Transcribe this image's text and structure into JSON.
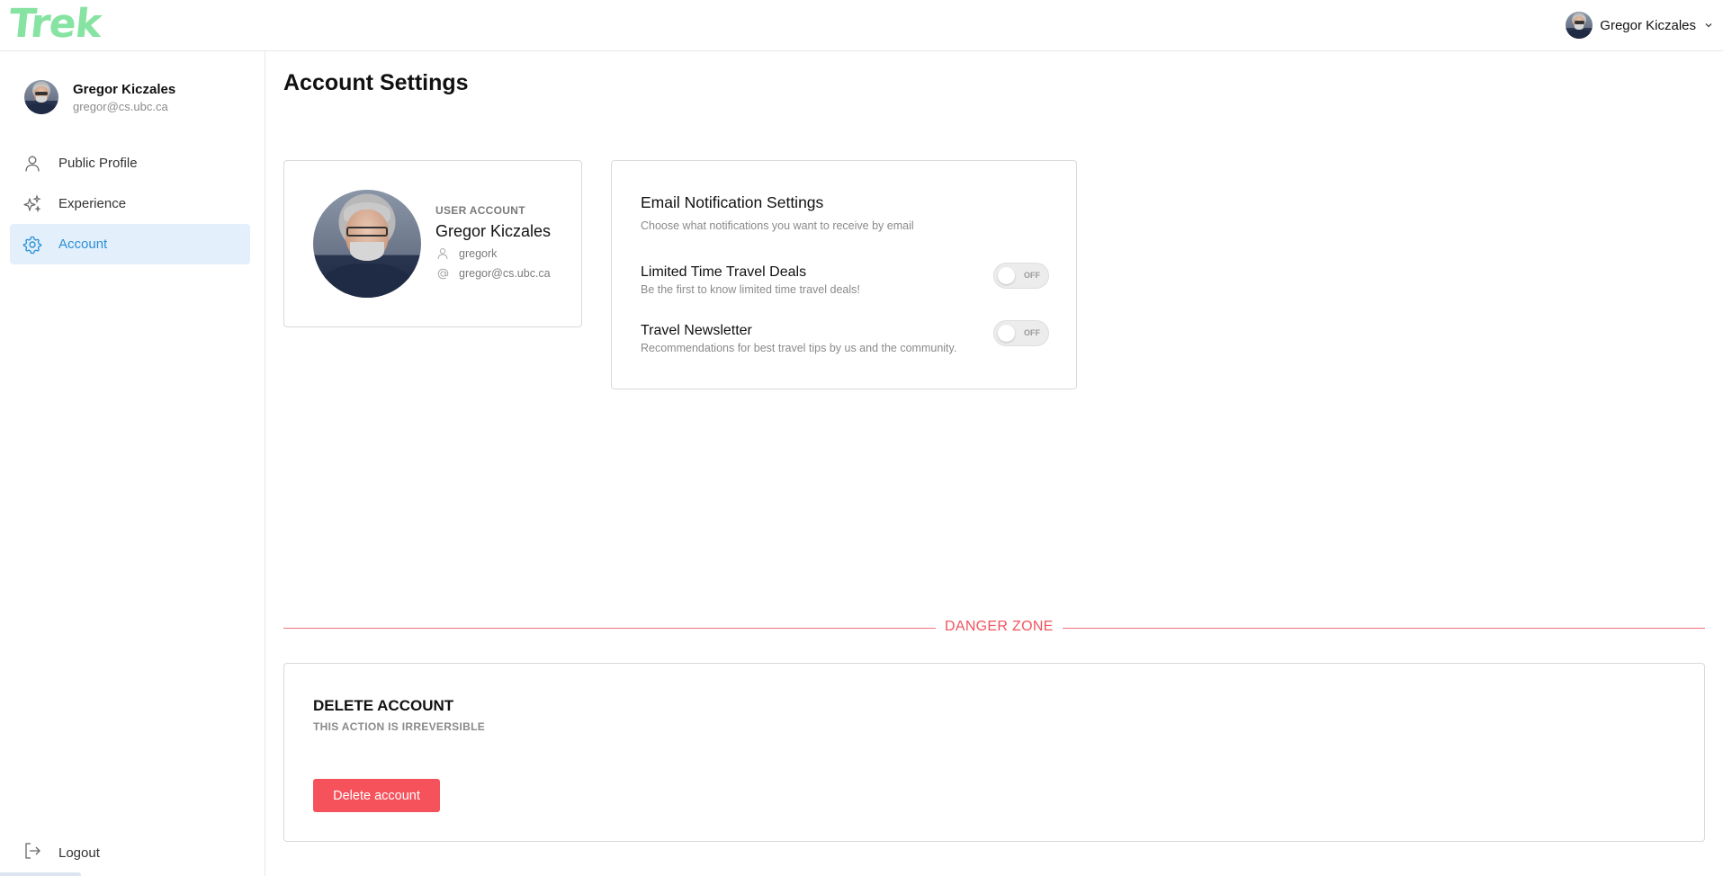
{
  "header": {
    "logo": "Trek",
    "user_name": "Gregor Kiczales"
  },
  "sidebar": {
    "user": {
      "name": "Gregor Kiczales",
      "email": "gregor@cs.ubc.ca"
    },
    "items": [
      {
        "label": "Public Profile",
        "icon": "user-icon",
        "active": false
      },
      {
        "label": "Experience",
        "icon": "sparkles-icon",
        "active": false
      },
      {
        "label": "Account",
        "icon": "gear-icon",
        "active": true
      }
    ],
    "logout_label": "Logout"
  },
  "main": {
    "title": "Account Settings",
    "user_card": {
      "label": "USER ACCOUNT",
      "name": "Gregor Kiczales",
      "username": "gregork",
      "email": "gregor@cs.ubc.ca"
    },
    "notifications": {
      "title": "Email Notification Settings",
      "subtitle": "Choose what notifications you want to receive by email",
      "items": [
        {
          "title": "Limited Time Travel Deals",
          "description": "Be the first to know limited time travel deals!",
          "state": "OFF"
        },
        {
          "title": "Travel Newsletter",
          "description": "Recommendations for best travel tips by us and the community.",
          "state": "OFF"
        }
      ]
    },
    "danger_zone": {
      "label": "DANGER ZONE",
      "title": "DELETE ACCOUNT",
      "subtitle": "THIS ACTION IS IRREVERSIBLE",
      "button_label": "Delete account"
    }
  },
  "colors": {
    "brand": "#86e3a2",
    "active_nav_bg": "#e3f0fb",
    "active_nav_text": "#2b8fd6",
    "danger": "#f6525b"
  }
}
